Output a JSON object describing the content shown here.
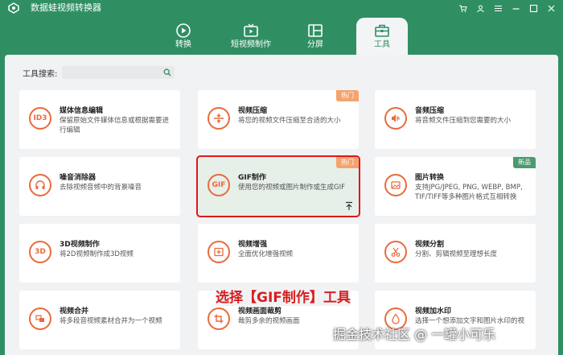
{
  "app": {
    "title": "数据蛙视频转换器"
  },
  "nav": {
    "tabs": [
      {
        "label": "转换"
      },
      {
        "label": "短视频制作"
      },
      {
        "label": "分屏"
      },
      {
        "label": "工具",
        "active": true
      }
    ]
  },
  "search": {
    "label": "工具搜索:",
    "value": "",
    "placeholder": ""
  },
  "cards": [
    {
      "title": "媒体信息编辑",
      "desc": "保留原始文件媒体信息或根据需要进行编辑",
      "icon": "id3-icon",
      "icon_text": "ID3"
    },
    {
      "title": "视频压缩",
      "desc": "将您的视频文件压缩至合适的大小",
      "icon": "compress-icon",
      "badge": "热门"
    },
    {
      "title": "音频压缩",
      "desc": "将音频文件压缩到您需要的大小",
      "icon": "audio-compress-icon"
    },
    {
      "title": "噪音消除器",
      "desc": "去除视频音频中的背景噪音",
      "icon": "headphones-icon"
    },
    {
      "title": "GIF制作",
      "desc": "使用您的视频或图片制作或生成GIF",
      "icon": "gif-icon",
      "icon_text": "GIF",
      "badge": "热门"
    },
    {
      "title": "图片转换",
      "desc": "支持JPG/JPEG, PNG, WEBP, BMP, TIF/TIFF等多种图片格式互相转换",
      "icon": "image-convert-icon",
      "badge": "新品"
    },
    {
      "title": "3D视频制作",
      "desc": "将2D视频制作成3D视频",
      "icon": "3d-icon",
      "icon_text": "3D"
    },
    {
      "title": "视频增强",
      "desc": "全面优化增强视频",
      "icon": "enhance-icon"
    },
    {
      "title": "视频分割",
      "desc": "分割、剪辑视频至理想长度",
      "icon": "scissors-icon"
    },
    {
      "title": "视频合并",
      "desc": "将多段音视频素材合并为一个视频",
      "icon": "merge-icon"
    },
    {
      "title": "视频画面裁剪",
      "desc": "裁剪多余的视频画面",
      "icon": "crop-icon"
    },
    {
      "title": "视频加水印",
      "desc": "选择一个想添加文字和图片水印的视",
      "icon": "watermark-icon"
    }
  ],
  "annotation": "选择【GIF制作】工具",
  "watermark": "掘金技术社区 @ 一罐小可乐",
  "colors": {
    "brand": "#2f8f63",
    "accent": "#ea6a3c",
    "hot_badge": "#f5a36e",
    "new_badge": "#4b9a6e",
    "highlight": "#e01818"
  }
}
